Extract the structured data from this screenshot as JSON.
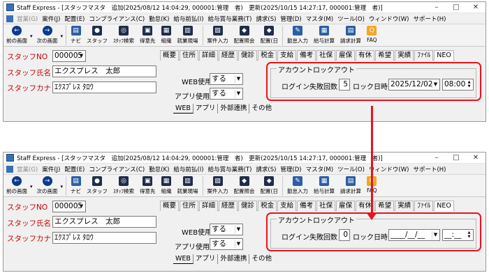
{
  "colors": {
    "highlight": "#e8131c",
    "required_label": "#d10000",
    "toolbar_nav": "#0b3b8c"
  },
  "menu": [
    {
      "label": "営業(G)",
      "disabled": true
    },
    {
      "label": "案件(J)",
      "disabled": false
    },
    {
      "label": "配置(E)",
      "disabled": false
    },
    {
      "label": "コンプライアンス(C)",
      "disabled": false
    },
    {
      "label": "勤怠(K)",
      "disabled": false
    },
    {
      "label": "給与前払(I)",
      "disabled": false
    },
    {
      "label": "給与賞与業務(T)",
      "disabled": false
    },
    {
      "label": "請求(S)",
      "disabled": false
    },
    {
      "label": "管理(D)",
      "disabled": false
    },
    {
      "label": "マスタ(M)",
      "disabled": false
    },
    {
      "label": "ツール(O)",
      "disabled": false
    },
    {
      "label": "ウィンドウ(W)",
      "disabled": false
    },
    {
      "label": "サポート(H)",
      "disabled": false
    }
  ],
  "toolbar": [
    {
      "label": "前の画面",
      "icon": "back-arrow-icon",
      "kind": "nav",
      "glyph": "←",
      "dropdown": true
    },
    {
      "label": "次の画面",
      "icon": "forward-arrow-icon",
      "kind": "nav",
      "glyph": "→",
      "dropdown": true
    },
    {
      "label": "ナビ",
      "icon": "navi-icon",
      "kind": "sq",
      "glyph": "▤",
      "sep": true
    },
    {
      "label": "スタッフ",
      "icon": "staff-icon",
      "kind": "dk",
      "glyph": "●"
    },
    {
      "label": "ｽﾀｯﾌ検索",
      "icon": "staff-search-icon",
      "kind": "dk",
      "glyph": "◎"
    },
    {
      "label": "得意先",
      "icon": "client-icon",
      "kind": "dk",
      "glyph": "▣"
    },
    {
      "label": "組織",
      "icon": "organization-icon",
      "kind": "dk",
      "glyph": "▦"
    },
    {
      "label": "就業現場",
      "icon": "worksite-icon",
      "kind": "dk",
      "glyph": "▥"
    },
    {
      "label": "案件入力",
      "icon": "job-entry-icon",
      "kind": "dk",
      "glyph": "▧",
      "sep": true
    },
    {
      "label": "配置照会",
      "icon": "assignment-lookup-icon",
      "kind": "dk",
      "glyph": "◆"
    },
    {
      "label": "配置(日",
      "icon": "assignment-daily-icon",
      "kind": "dk",
      "glyph": "◆"
    },
    {
      "label": "勤怠入力",
      "icon": "attendance-entry-icon",
      "kind": "sq",
      "glyph": "✎",
      "sep": true
    },
    {
      "label": "給与計算",
      "icon": "payroll-calc-icon",
      "kind": "sq",
      "glyph": "▦"
    },
    {
      "label": "請求計算",
      "icon": "billing-calc-icon",
      "kind": "sq",
      "glyph": "▤"
    },
    {
      "label": "FAQ",
      "icon": "faq-icon",
      "kind": "faq",
      "glyph": "Q"
    }
  ],
  "tabs": [
    "概要",
    "住所",
    "詳細",
    "経歴",
    "健診",
    "税金",
    "支給",
    "備考",
    "社保",
    "雇保",
    "有休",
    "希望",
    "実績",
    "ﾌｧｲﾙ",
    "NEO"
  ],
  "active_tab": 14,
  "subtabs": [
    "WEB",
    "アプリ",
    "外部連携",
    "その他"
  ],
  "window_controls": [
    "–",
    "□",
    "✕"
  ],
  "before": {
    "title": "Staff Express - [スタッフマスタ　追加(2025/08/12 14:04:29, 000001:管理　者)　更新(2025/10/15 14:27:17, 000001:管理　者)]",
    "staff_no_label": "スタッフNO",
    "staff_no": "000005",
    "staff_name_label": "スタッフ氏名",
    "staff_name": "エクスプレス　太郎",
    "staff_kana_label": "スタッフカナ",
    "staff_kana": "ｴｸｽﾌﾟﾚｽ ﾀﾛｳ",
    "web_use_label": "WEB使用",
    "web_use": "する",
    "app_use_label": "アプリ使用",
    "app_use": "する",
    "lock_group_title": "アカウントロックアウト",
    "failures_label": "ログイン失敗回数",
    "failures": "5",
    "lock_time_label": "ロック日時",
    "lock_date": "2025/12/02",
    "lock_time": "08:00"
  },
  "after": {
    "title": "Staff Express - [スタッフマスタ　追加(2025/08/12 14:04:29, 000001:管理　者)　更新(2025/10/15 14:27:17, 000001:管理　者)]",
    "staff_no_label": "スタッフNO",
    "staff_no": "000005",
    "staff_name_label": "スタッフ氏名",
    "staff_name": "エクスプレス　太郎",
    "staff_kana_label": "スタッフカナ",
    "staff_kana": "ｴｸｽﾌﾟﾚｽ ﾀﾛｳ",
    "web_use_label": "WEB使用",
    "web_use": "する",
    "app_use_label": "アプリ使用",
    "app_use": "する",
    "lock_group_title": "アカウントロックアウト",
    "failures_label": "ログイン失敗回数",
    "failures": "0",
    "lock_time_label": "ロック日時",
    "lock_date": "____/__/__",
    "lock_time": "__:__"
  }
}
